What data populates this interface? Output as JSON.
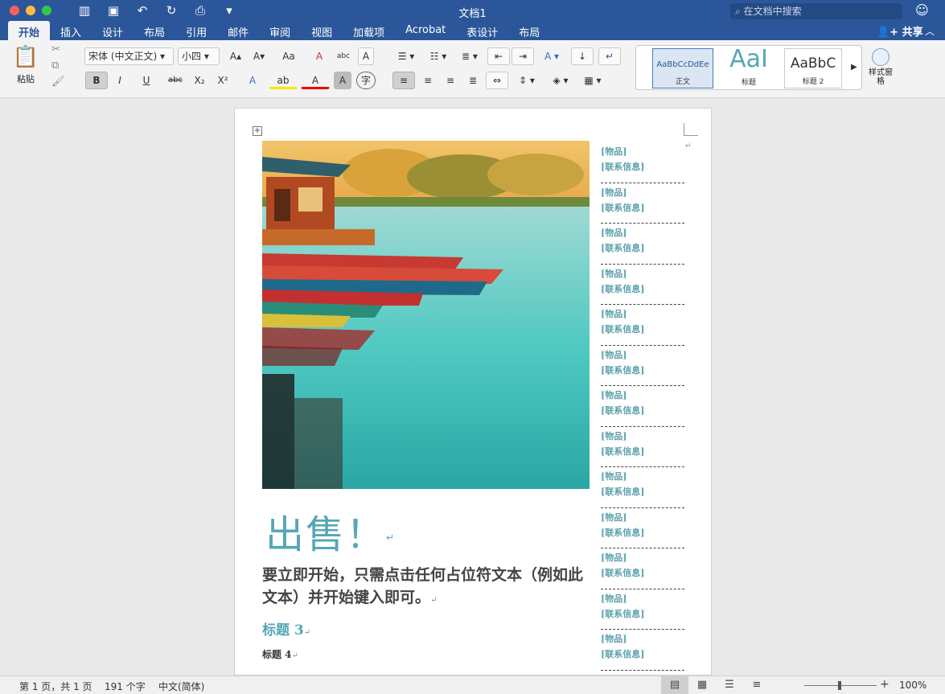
{
  "window": {
    "title": "文档1",
    "search_placeholder": "在文档中搜索",
    "share_label": "共享"
  },
  "tabs": [
    "开始",
    "插入",
    "设计",
    "布局",
    "引用",
    "邮件",
    "审阅",
    "视图",
    "加载项",
    "Acrobat",
    "表设计",
    "布局"
  ],
  "ribbon": {
    "paste_label": "粘贴",
    "font_name": "宋体 (中文正文)",
    "font_size": "小四",
    "styles": [
      {
        "sample": "AaBbCcDdEe",
        "name": "正文"
      },
      {
        "sample": "AaI",
        "name": "标题"
      },
      {
        "sample": "AaBbC",
        "name": "标题 2"
      }
    ],
    "style_pane_label": "样式窗格",
    "buttons": {
      "grow": "A▴",
      "shrink": "A▾",
      "case": "Aa",
      "clear": "A",
      "phonetic": "abc",
      "border_char": "A",
      "bold": "B",
      "italic": "I",
      "underline": "U",
      "strike": "abc",
      "sub": "X₂",
      "sup": "X²",
      "effects": "A",
      "highlight": "ab",
      "color": "A",
      "shading": "A",
      "enclose": "字"
    }
  },
  "document": {
    "headline": "出售！",
    "intro": "要立即开始，只需点击任何占位符文本（例如此文本）并开始键入即可。",
    "heading3": "标题 3",
    "heading4": "标题 4",
    "tearoff_item": "[物品]",
    "tearoff_contact": "[联系信息]"
  },
  "status": {
    "page": "第 1 页，共 1 页",
    "words": "191 个字",
    "language": "中文(简体)",
    "zoom": "100%"
  }
}
